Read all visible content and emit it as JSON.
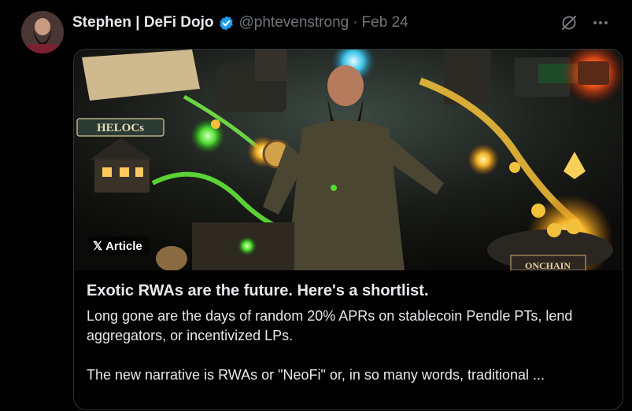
{
  "tweet": {
    "author_name": "Stephen | DeFi Dojo",
    "handle": "@phtevenstrong",
    "separator": "·",
    "date": "Feb 24"
  },
  "card": {
    "badge_x": "𝕏",
    "badge_label": "Article",
    "image_signs": {
      "left": "HELOCs",
      "right": "ONCHAIN"
    },
    "title": "Exotic RWAs are the future. Here's a shortlist.",
    "desc_para1": "Long gone are the days of random 20% APRs on stablecoin Pendle PTs, lend aggregators, or incentivized LPs.",
    "desc_para2": "The new narrative is RWAs or \"NeoFi\" or, in so many words, traditional ..."
  },
  "colors": {
    "verified": "#1d9bf0",
    "muted": "#71767b",
    "text": "#e7e9ea",
    "border": "#2f3336"
  }
}
